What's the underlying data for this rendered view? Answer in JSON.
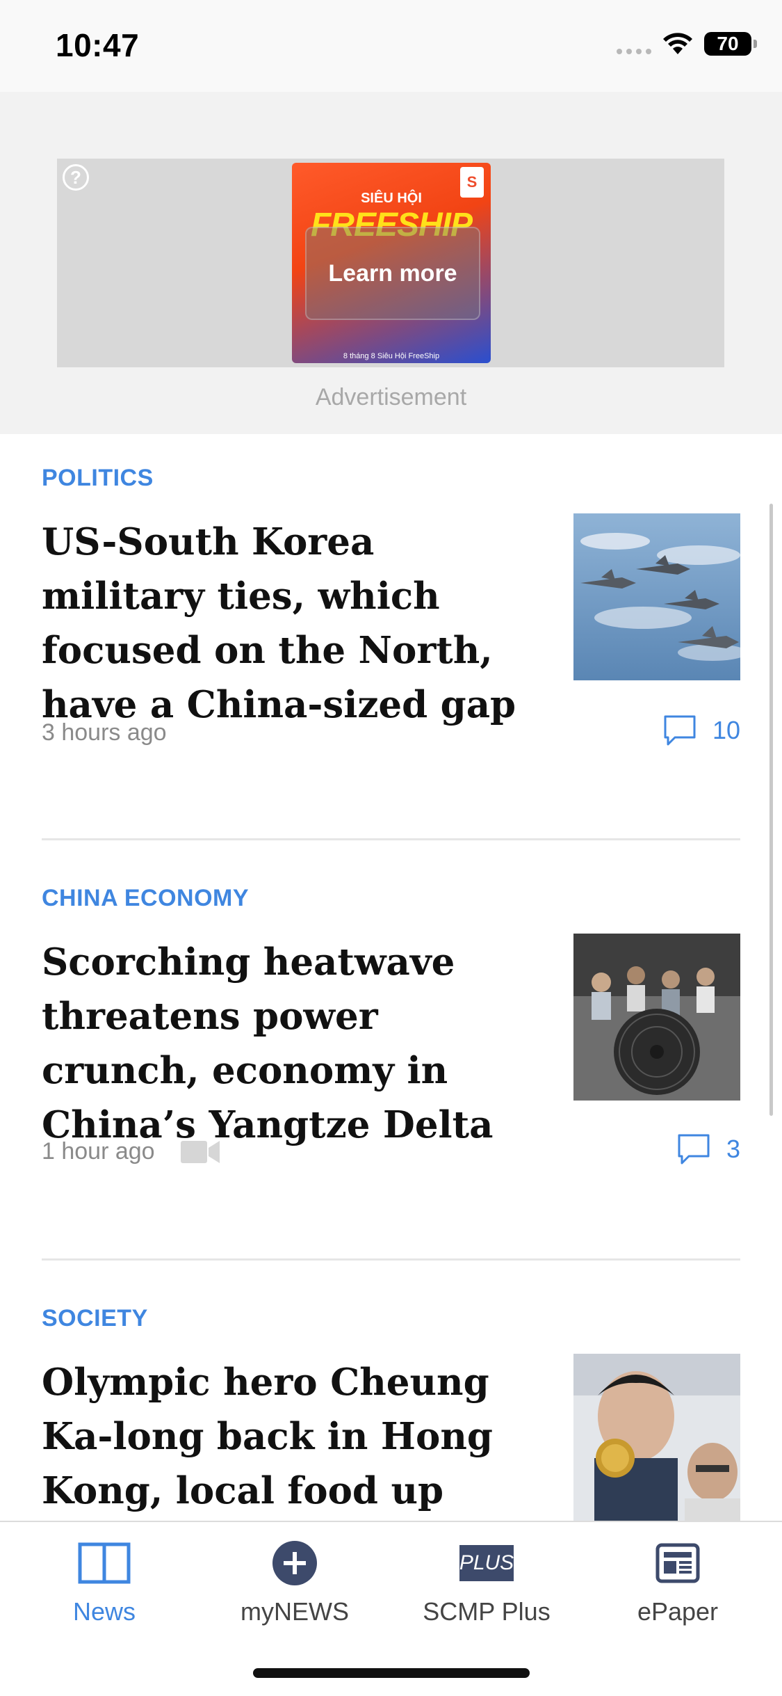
{
  "status_bar": {
    "time": "10:47",
    "battery": "70"
  },
  "ad": {
    "banner_top": "SIÊU HỘI",
    "banner_main": "FREESHIP",
    "brand": "S",
    "cta": "Learn more",
    "banner_foot": "8 tháng 8 Siêu Hội FreeShip",
    "label": "Advertisement"
  },
  "articles": [
    {
      "category": "POLITICS",
      "headline": "US-South Korea military ties, which focused on the North, have a China-sized gap",
      "time": "3 hours ago",
      "comments": "10",
      "has_video": false,
      "thumbnail": "fighter-jets-photo"
    },
    {
      "category": "CHINA ECONOMY",
      "headline": "Scorching heatwave threatens power crunch, economy in China’s Yangtze Delta",
      "time": "1 hour ago",
      "comments": "3",
      "has_video": true,
      "thumbnail": "heatwave-fan-photo"
    },
    {
      "category": "SOCIETY",
      "headline": "Olympic hero Cheung Ka-long back in Hong Kong, local food up next – as it",
      "thumbnail": "olympic-medal-photo"
    }
  ],
  "tabs": [
    {
      "label": "News",
      "icon": "news-book-icon",
      "active": true
    },
    {
      "label": "myNEWS",
      "icon": "plus-circle-icon",
      "active": false
    },
    {
      "label": "SCMP Plus",
      "icon": "plus-badge-icon",
      "badge": "PLUS",
      "active": false
    },
    {
      "label": "ePaper",
      "icon": "epaper-icon",
      "active": false
    }
  ],
  "colors": {
    "accent": "#3f86e0",
    "text": "#111111",
    "meta": "#8a8a8a",
    "navy": "#3d4a6b"
  }
}
